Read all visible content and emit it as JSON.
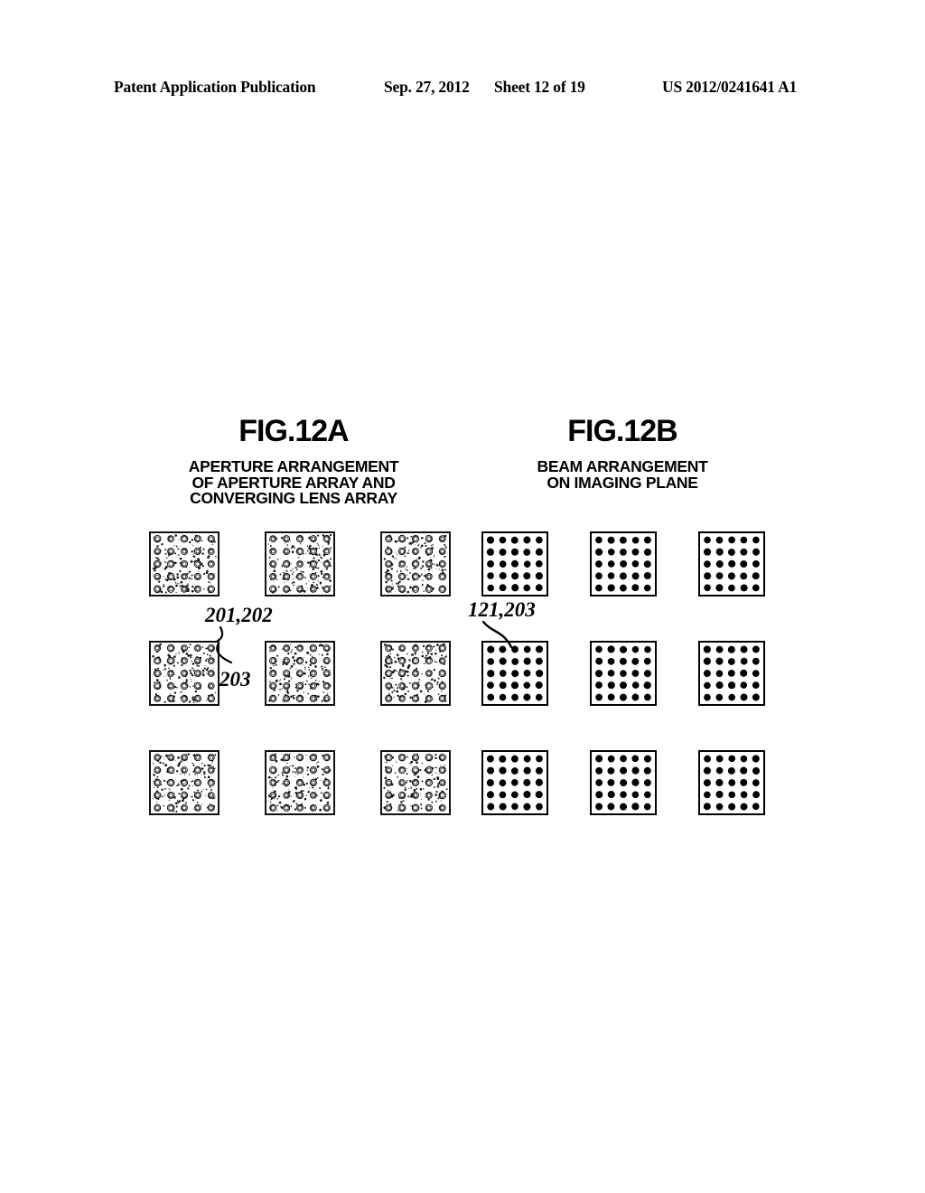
{
  "header": {
    "publication": "Patent Application Publication",
    "date": "Sep. 27, 2012",
    "sheet": "Sheet 12 of 19",
    "document_number": "US 2012/0241641 A1"
  },
  "figures": [
    {
      "id": "fig12a",
      "title": "FIG.12A",
      "subtitle_lines": [
        "APERTURE ARRANGEMENT",
        "OF APERTURE ARRAY AND",
        "CONVERGING LENS ARRAY"
      ],
      "block_kind": "aperture-ring-array",
      "block_grid": {
        "rows": 3,
        "cols": 3
      },
      "sub_grid": {
        "rows": 5,
        "cols": 5
      },
      "reference_labels": [
        {
          "text": "201,202",
          "target": "block-top-right-corner"
        },
        {
          "text": "203",
          "target": "aperture-ring"
        }
      ]
    },
    {
      "id": "fig12b",
      "title": "FIG.12B",
      "subtitle_lines": [
        "BEAM ARRANGEMENT",
        "ON IMAGING PLANE"
      ],
      "block_kind": "beam-dot-array",
      "block_grid": {
        "rows": 3,
        "cols": 3
      },
      "sub_grid": {
        "rows": 5,
        "cols": 5
      },
      "reference_labels": [
        {
          "text": "121,203",
          "target": "beam-dot"
        }
      ]
    }
  ],
  "colors": {
    "ink": "#000000",
    "paper": "#ffffff"
  }
}
